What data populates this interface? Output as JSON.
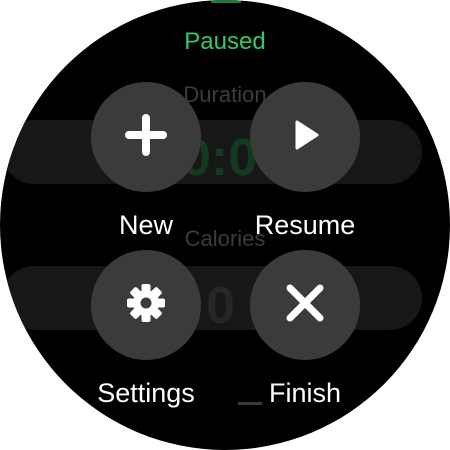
{
  "status": "Paused",
  "background": {
    "duration_label": "Duration",
    "duration_value": "0:0",
    "calories_label": "Calories",
    "calories_value": "0"
  },
  "menu": {
    "new": {
      "label": "New",
      "icon": "plus-icon"
    },
    "resume": {
      "label": "Resume",
      "icon": "play-icon"
    },
    "settings": {
      "label": "Settings",
      "icon": "gear-icon"
    },
    "finish": {
      "label": "Finish",
      "icon": "close-icon"
    }
  },
  "colors": {
    "status": "#2ecc63",
    "button_bg": "#3b3b3b",
    "background": "#000000"
  }
}
